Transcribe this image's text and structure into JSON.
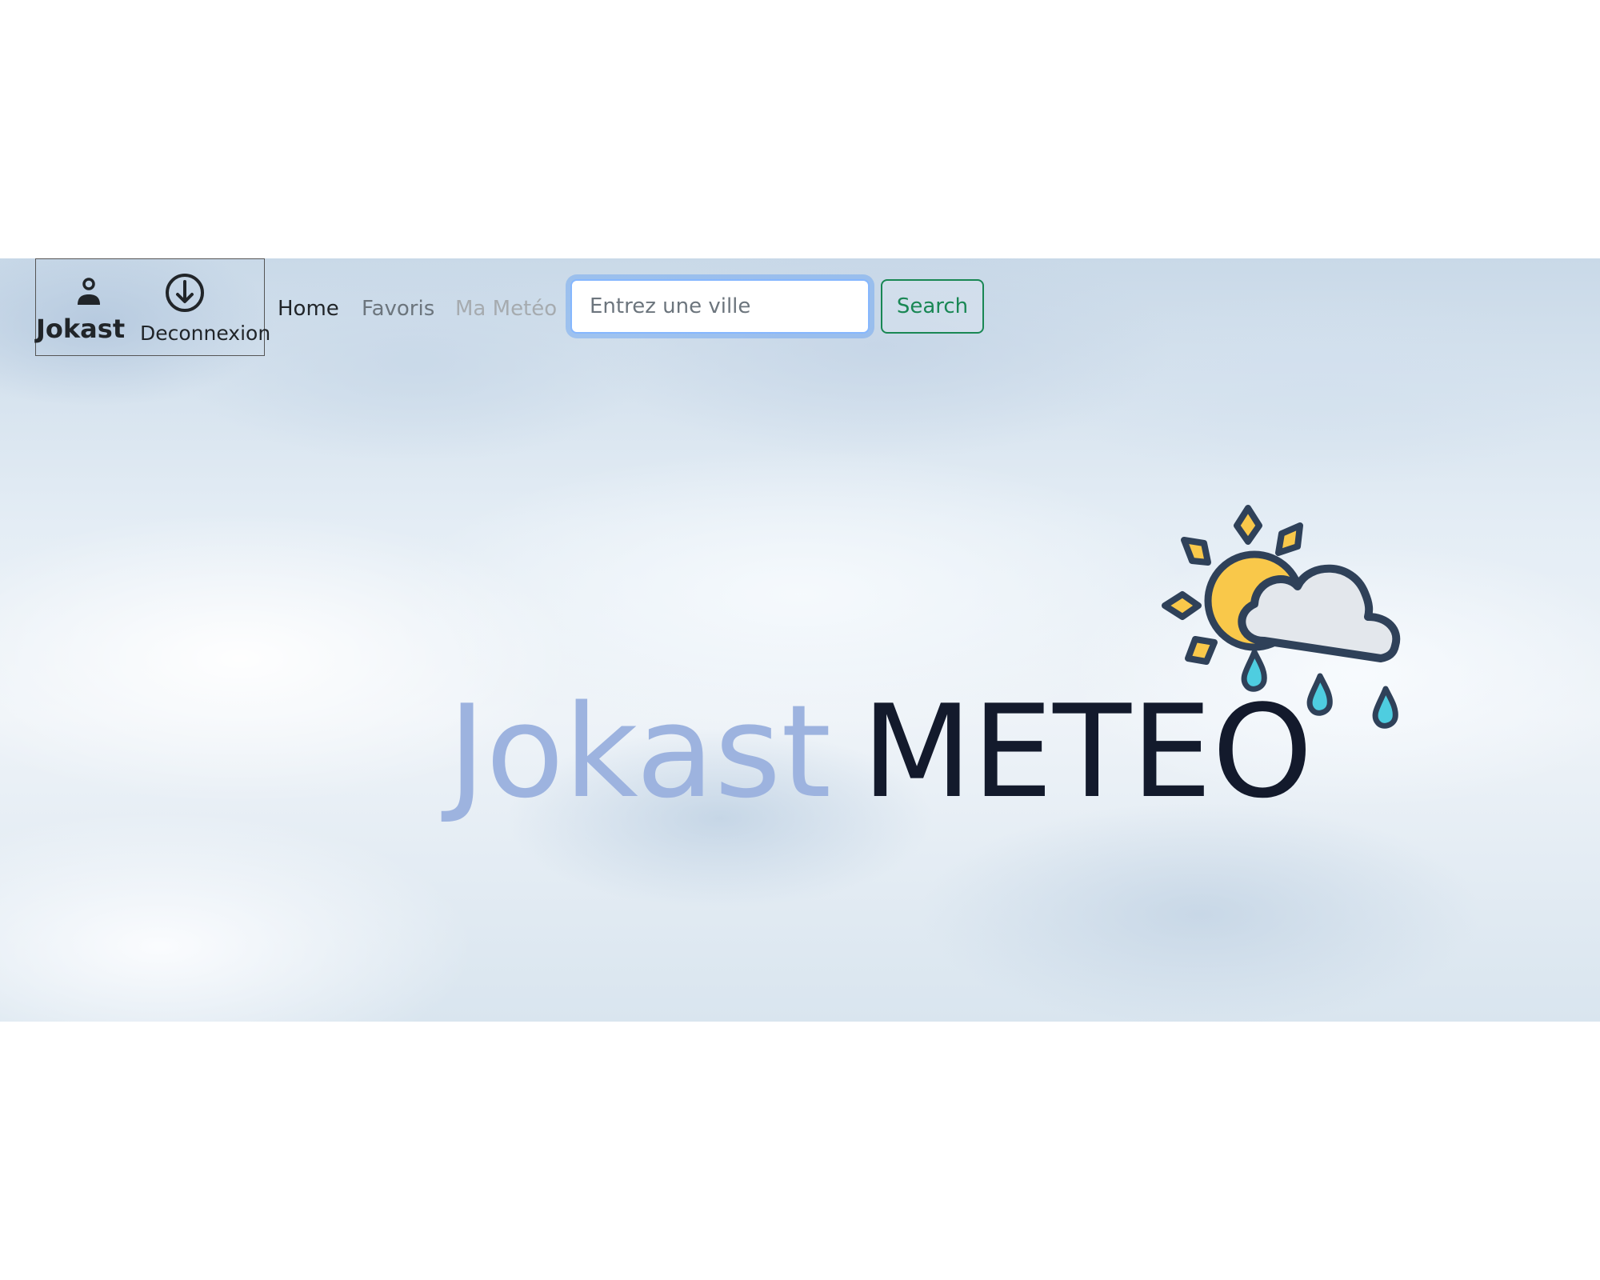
{
  "navbar": {
    "user_name": "Jokast",
    "logout_label": "Deconnexion",
    "links": {
      "home": "Home",
      "favoris": "Favoris",
      "ma_meteo": "Ma Metéo"
    },
    "search": {
      "placeholder": "Entrez une ville",
      "value": "",
      "button_label": "Search"
    }
  },
  "hero": {
    "title_part1": "Jokast",
    "title_part2": "METEO",
    "logo_icon": "sun-cloud-rain-icon"
  },
  "icons": {
    "user": "user-icon",
    "logout": "logout-icon"
  },
  "colors": {
    "title_light": "#9db3df",
    "title_dark": "#131a2c",
    "search_accent": "#198754",
    "focus_ring": "#86b7fe"
  }
}
